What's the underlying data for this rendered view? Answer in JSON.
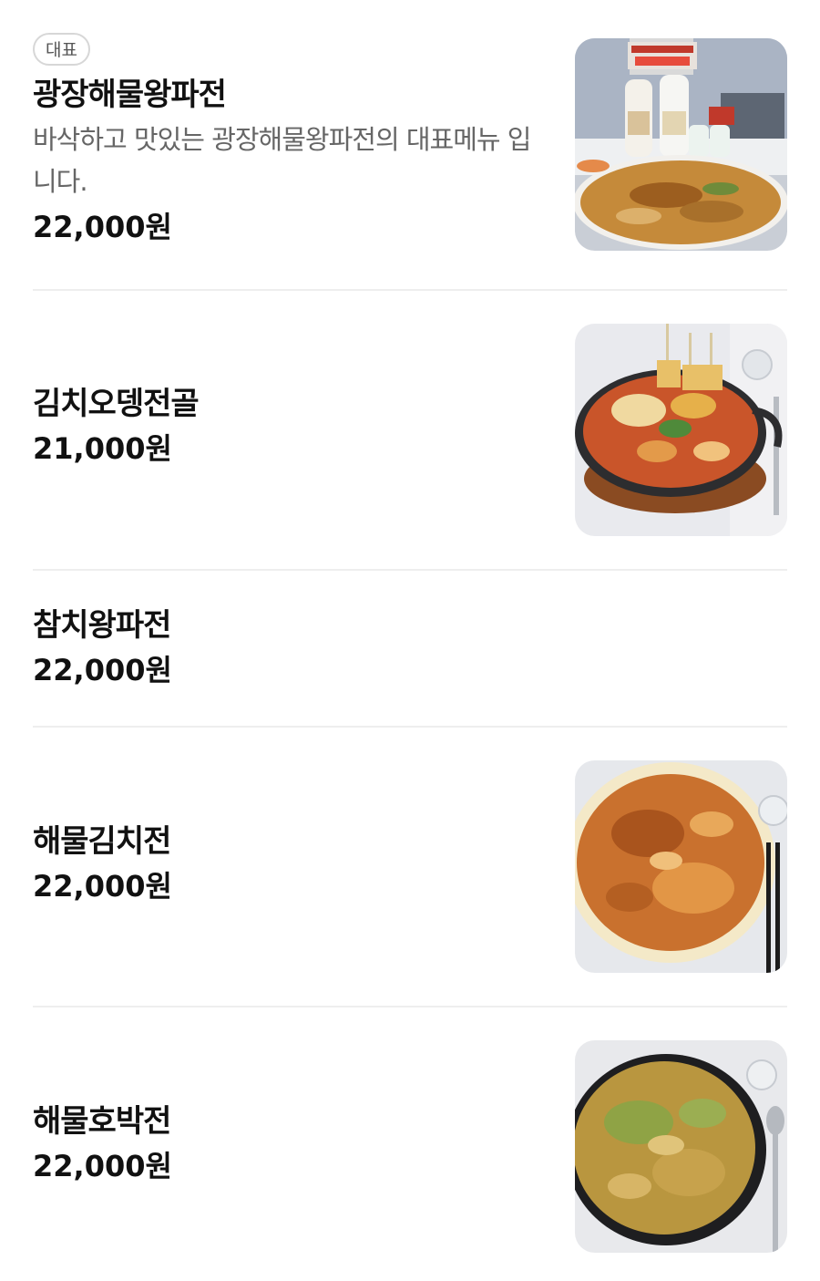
{
  "menu": {
    "items": [
      {
        "badge": "대표",
        "name": "광장해물왕파전",
        "description": "바삭하고 맛있는 광장해물왕파전의 대표메뉴 입니다.",
        "price": "22,000원",
        "photo": "seafood-pancake-with-makgeolli-photo"
      },
      {
        "name": "김치오뎅전골",
        "price": "21,000원",
        "photo": "kimchi-fishcake-hotpot-photo"
      },
      {
        "name": "참치왕파전",
        "price": "22,000원"
      },
      {
        "name": "해물김치전",
        "price": "22,000원",
        "photo": "seafood-kimchi-pancake-photo"
      },
      {
        "name": "해물호박전",
        "price": "22,000원",
        "photo": "seafood-zucchini-pancake-photo"
      }
    ]
  },
  "colors": {
    "text": "#111111",
    "description": "#666666",
    "divider": "#eeeeee",
    "badge_border": "#d7d7d7"
  }
}
